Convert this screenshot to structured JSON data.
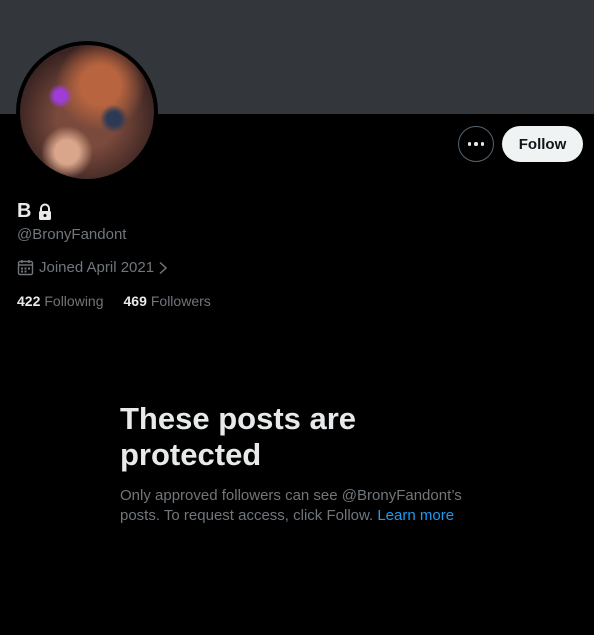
{
  "profile": {
    "name": "B",
    "handle": "@BronyFandont",
    "joined": "Joined April 2021",
    "following_count": "422",
    "following_label": "Following",
    "followers_count": "469",
    "followers_label": "Followers",
    "is_protected": true
  },
  "actions": {
    "follow_label": "Follow",
    "more_icon": "more-icon"
  },
  "protected_notice": {
    "title": "These posts are protected",
    "body": "Only approved followers can see @BronyFandont’s posts. To request access, click Follow.",
    "link_text": "Learn more"
  },
  "colors": {
    "background": "#000000",
    "banner": "#33363a",
    "primary_text": "#e7e9ea",
    "secondary_text": "#71767b",
    "link": "#1d9bf0",
    "follow_button_bg": "#eff3f4"
  }
}
